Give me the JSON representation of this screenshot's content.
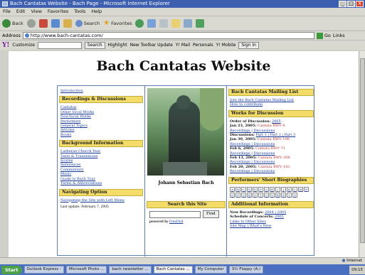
{
  "window": {
    "title": "Bach Cantatas Website - Bach Page - Microsoft Internet Explorer",
    "minimize": "_",
    "maximize": "□",
    "close": "X"
  },
  "menu": [
    "File",
    "Edit",
    "View",
    "Favorites",
    "Tools",
    "Help"
  ],
  "toolbar": {
    "back": "Back",
    "search": "Search",
    "favorites": "Favorites"
  },
  "address": {
    "label": "Address",
    "url": "http://www.bach-cantatas.com/",
    "go": "Go",
    "links": "Links"
  },
  "yahoo": {
    "logo": "Y!",
    "customize": "Customize",
    "search_btn": "Search",
    "highlight": "Highlight",
    "update": "New Toolbar Update",
    "mail": "Y! Mail",
    "personals": "Personals",
    "mobile": "Y! Mobile",
    "signin": "Sign In"
  },
  "site": {
    "title": "Bach Cantatas Website"
  },
  "left": {
    "intro": "Introduction",
    "sec1": {
      "title": "Recordings & Discussions",
      "items": [
        "Cantatas",
        "Other Vocal Works",
        "Non-Vocal Works",
        "Performers",
        "General Topics",
        "Articles",
        "Books"
      ]
    },
    "sec2": {
      "title": "Background Information",
      "items": [
        "Lutheran Church Year",
        "Texts & Translations",
        "Scores",
        "References",
        "Commentary",
        "Music",
        "Guide to Bach Tour",
        "Terms & Abbreviations"
      ]
    },
    "sec3": {
      "title": "Navigating Option",
      "items": [
        "Navigating the Site with Left Menu"
      ]
    },
    "updated": "Last update: February 7, 2005"
  },
  "middle": {
    "caption": "Johann Sebastian Bach",
    "search_title": "Search this Site",
    "find": "Find",
    "powered": "powered by",
    "powered_link": "FreeFind"
  },
  "right": {
    "mailing": {
      "title": "Bach Cantatas Mailing List",
      "join": "Join the Bach Cantatas Mailing List",
      "contribute": "How to contribute"
    },
    "works": {
      "title": "Works for Discussion",
      "order": "Order of Discussion:",
      "order_link": "2005",
      "rows": [
        {
          "date": "Jan 23, 2005:",
          "work": "Cantata BWV 8",
          "links": "Recordings | Discussions"
        },
        {
          "date": "Discussions:",
          "work": "",
          "links": "Part 1 | Part 2 | Part 3"
        },
        {
          "date": "Jan 30, 2005:",
          "work": "Cantata BWV 196",
          "links": "Recordings | Discussions"
        },
        {
          "date": "Feb 6, 2005:",
          "work": "Cantata BWV 71",
          "links": "Recordings | Discussions"
        },
        {
          "date": "Feb 13, 2005:",
          "work": "Cantata BWV 208",
          "links": "Recordings | Discussions"
        },
        {
          "date": "Feb 20, 2005:",
          "work": "Cantata BWV 182",
          "links": "Recordings | Discussions"
        }
      ]
    },
    "bios": {
      "title": "Performers' Short Biographies",
      "letters": [
        "A",
        "B",
        "C",
        "D",
        "E",
        "F",
        "G",
        "H",
        "I",
        "J",
        "K",
        "L",
        "M",
        "N",
        "O",
        "P",
        "Q",
        "R",
        "S",
        "T",
        "U",
        "V",
        "W",
        "X",
        "Y",
        "Z"
      ]
    },
    "additional": {
      "title": "Additional Information",
      "new_label": "New Recordings:",
      "new_links": "2004 | 2005",
      "schedule_label": "Schedule of Concerts:",
      "schedule_link": "2005",
      "other": "Links to Other Sites",
      "sitemap": "Site Map | What's New"
    }
  },
  "status": {
    "zone": "Internet"
  },
  "taskbar": {
    "start": "Start",
    "tasks": [
      "Outlook Express -",
      "Microsoft Photo ...",
      "bach newsletter ...",
      "Bach Cantatas ...",
      "My Computer",
      "3½ Floppy (A:)"
    ],
    "clock": "09:15"
  },
  "colors": {
    "accent": "#f3dc68",
    "link": "#1a3a9a",
    "border": "#5f7fb0",
    "titlebar": "#3d5fb0"
  }
}
